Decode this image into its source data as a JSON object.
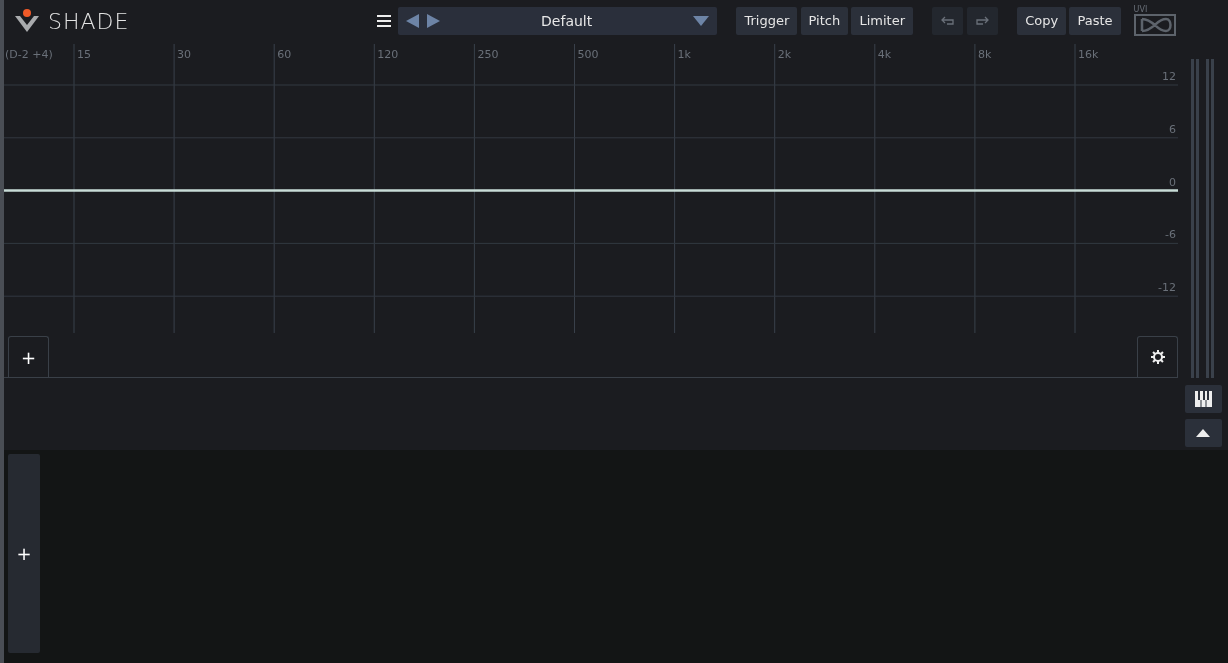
{
  "header": {
    "logo_text": "SHADE",
    "preset": {
      "name": "Default"
    },
    "mode_buttons": [
      {
        "label": "Trigger"
      },
      {
        "label": "Pitch"
      },
      {
        "label": "Limiter"
      }
    ],
    "clipboard_buttons": [
      {
        "label": "Copy"
      },
      {
        "label": "Paste"
      }
    ],
    "brand_text": "UVI"
  },
  "eq_graph": {
    "note_label": "(D-2 +4)",
    "add_band_button": "+",
    "frequency_labels": [
      "15",
      "30",
      "60",
      "120",
      "250",
      "500",
      "1k",
      "2k",
      "4k",
      "8k",
      "16k"
    ],
    "gain_labels": [
      "12",
      "6",
      "0",
      "-6",
      "-12"
    ]
  },
  "lower_panel": {
    "add_button": "+"
  }
}
